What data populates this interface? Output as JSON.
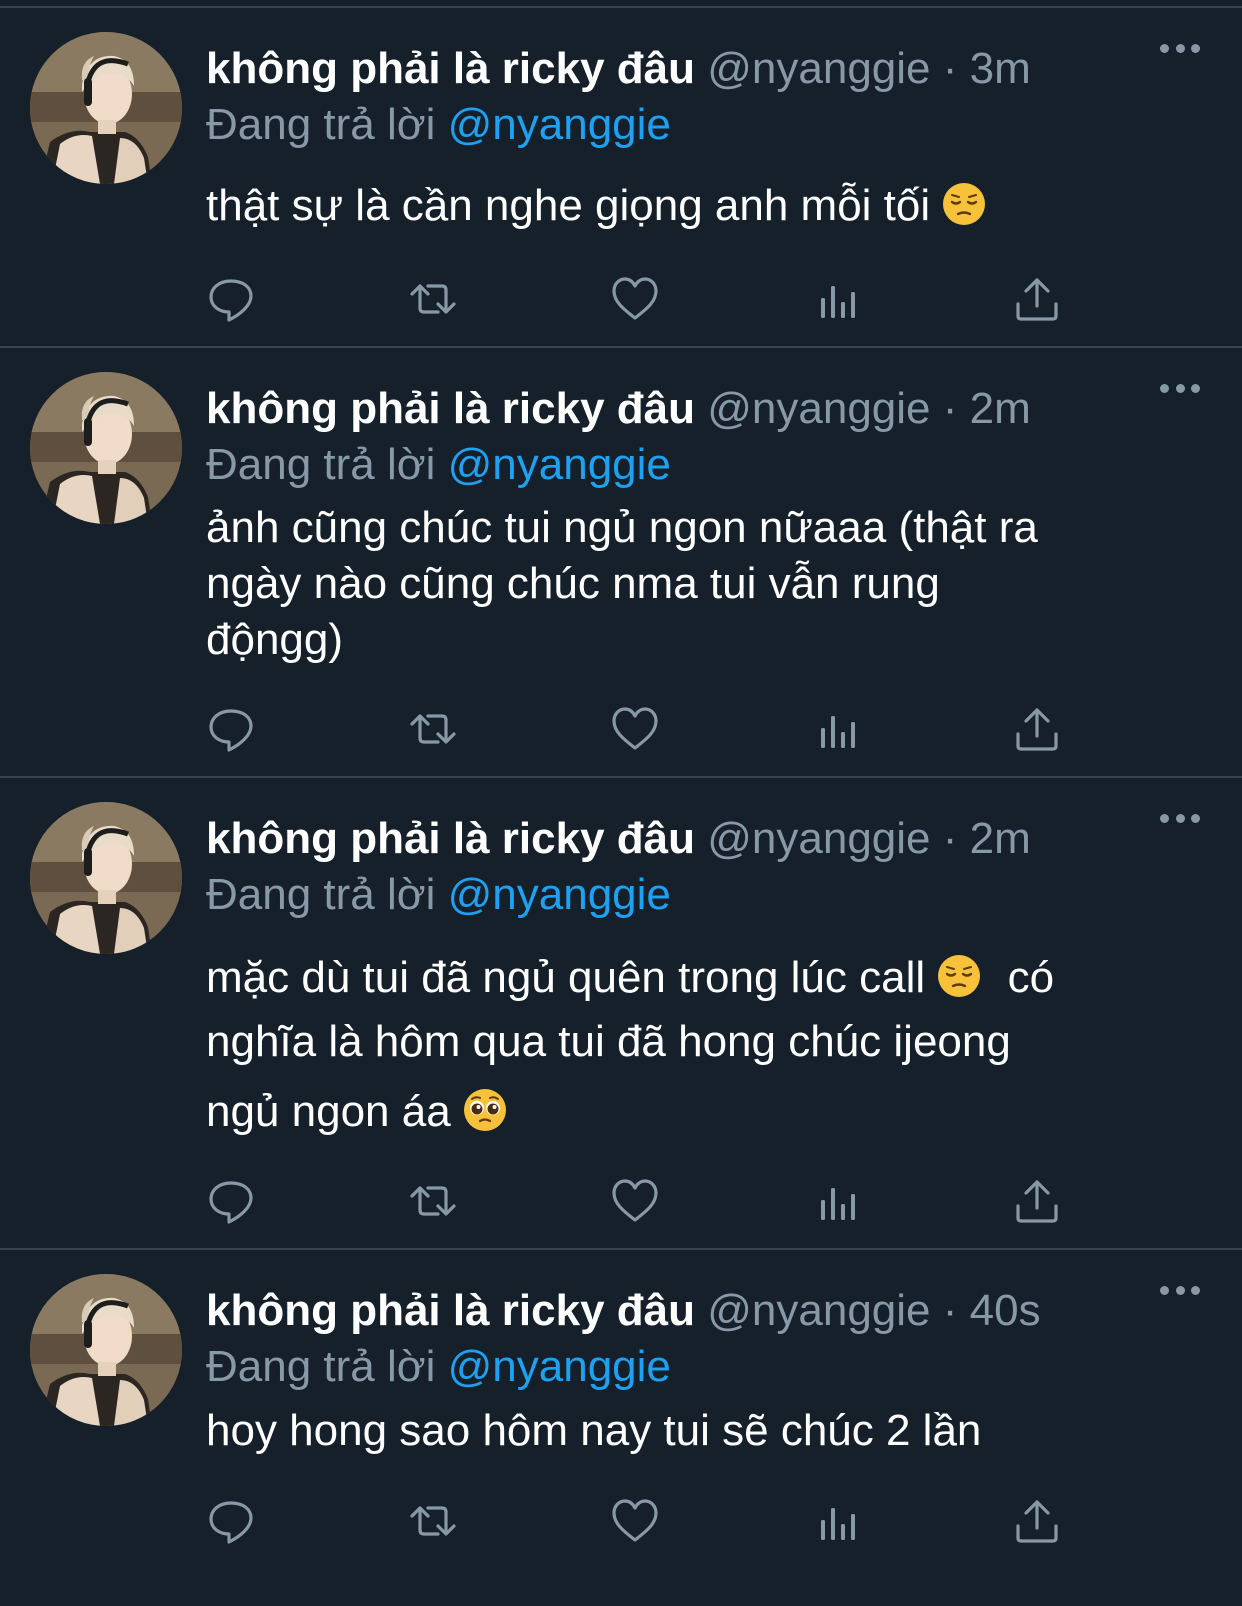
{
  "colors": {
    "background": "#15202b",
    "divider": "#38444d",
    "muted": "#8899a6",
    "link": "#1da1f2",
    "text": "#ffffff"
  },
  "reply_prefix": "Đang trả lời",
  "tweets": [
    {
      "name": "không phải là ricky đâu",
      "handle": "@nyanggie",
      "sep": "·",
      "time": "3m",
      "reply_to": "@nyanggie",
      "lines": [
        "thật sự là cần nghe giọng anh mỗi tối"
      ],
      "emoji": "pensive-face"
    },
    {
      "name": "không phải là ricky đâu",
      "handle": "@nyanggie",
      "sep": "·",
      "time": "2m",
      "reply_to": "@nyanggie",
      "lines": [
        "ảnh cũng chúc tui ngủ ngon nữaaa (thật ra",
        "ngày nào cũng chúc nma tui vẫn rung",
        "độngg)"
      ]
    },
    {
      "name": "không phải là ricky đâu",
      "handle": "@nyanggie",
      "sep": "·",
      "time": "2m",
      "reply_to": "@nyanggie",
      "lines": [
        "mặc dù tui đã ngủ quên trong lúc call",
        "có",
        "nghĩa là hôm qua tui đã hong chúc ijeong",
        "ngủ ngon áa"
      ],
      "emoji": [
        "pensive-face",
        "pleading-face"
      ]
    },
    {
      "name": "không phải là ricky đâu",
      "handle": "@nyanggie",
      "sep": "·",
      "time": "40s",
      "reply_to": "@nyanggie",
      "lines": [
        "hoy hong sao hôm nay tui sẽ chúc 2 lần"
      ]
    }
  ],
  "actions": [
    "reply-icon",
    "retweet-icon",
    "like-icon",
    "analytics-icon",
    "share-icon"
  ]
}
